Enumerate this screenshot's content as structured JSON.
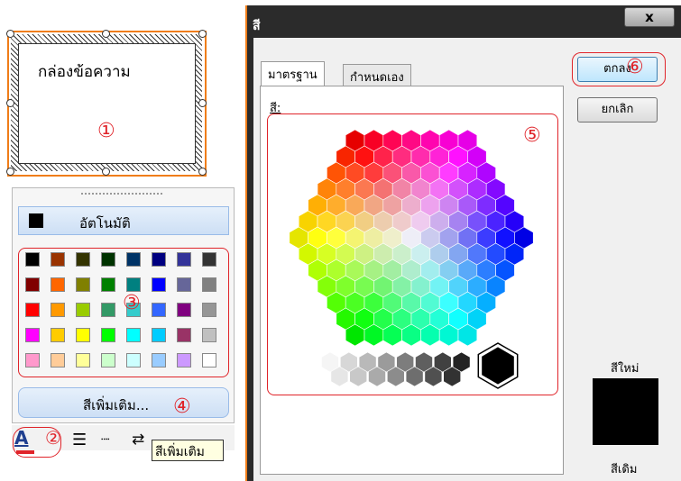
{
  "textbox": {
    "text": "กล่องข้อความ",
    "marker": "①"
  },
  "color_menu": {
    "automatic_label": "อัตโนมัติ",
    "automatic_color": "#000000",
    "palette": [
      [
        "#000000",
        "#993300",
        "#333300",
        "#003300",
        "#003366",
        "#000080",
        "#333399",
        "#333333"
      ],
      [
        "#800000",
        "#ff6600",
        "#808000",
        "#008000",
        "#008080",
        "#0000ff",
        "#666699",
        "#808080"
      ],
      [
        "#ff0000",
        "#ff9900",
        "#99cc00",
        "#339966",
        "#33cccc",
        "#3366ff",
        "#800080",
        "#969696"
      ],
      [
        "#ff00ff",
        "#ffcc00",
        "#ffff00",
        "#00ff00",
        "#00ffff",
        "#00ccff",
        "#993366",
        "#c0c0c0"
      ],
      [
        "#ff99cc",
        "#ffcc99",
        "#ffff99",
        "#ccffcc",
        "#ccffff",
        "#99ccff",
        "#cc99ff",
        "#ffffff"
      ]
    ],
    "more_label": "สีเพิ่มเติม...",
    "palette_marker": "③",
    "more_marker": "④"
  },
  "toolbar": {
    "font_color_glyph": "A",
    "marker": "②",
    "tooltip": "สีเพิ่มเติม",
    "line_glyph": "☰",
    "dash_glyph": "┈",
    "arrow_glyph": "⇄"
  },
  "dialog": {
    "title": "สี",
    "close_glyph": "x",
    "tabs": [
      "มาตรฐาน",
      "กำหนดเอง"
    ],
    "colors_label": "สี:",
    "ok_label": "ตกลง",
    "cancel_label": "ยกเลิก",
    "new_label": "สีใหม่",
    "current_label": "สีเดิม",
    "honeycomb_marker": "⑤",
    "ok_marker": "⑥",
    "new_color": "#000000",
    "current_color": "#000000"
  },
  "colors": {
    "accent_red": "#e0242a",
    "accent_orange": "#f07d18",
    "selection_blue": "#99bbe8"
  }
}
